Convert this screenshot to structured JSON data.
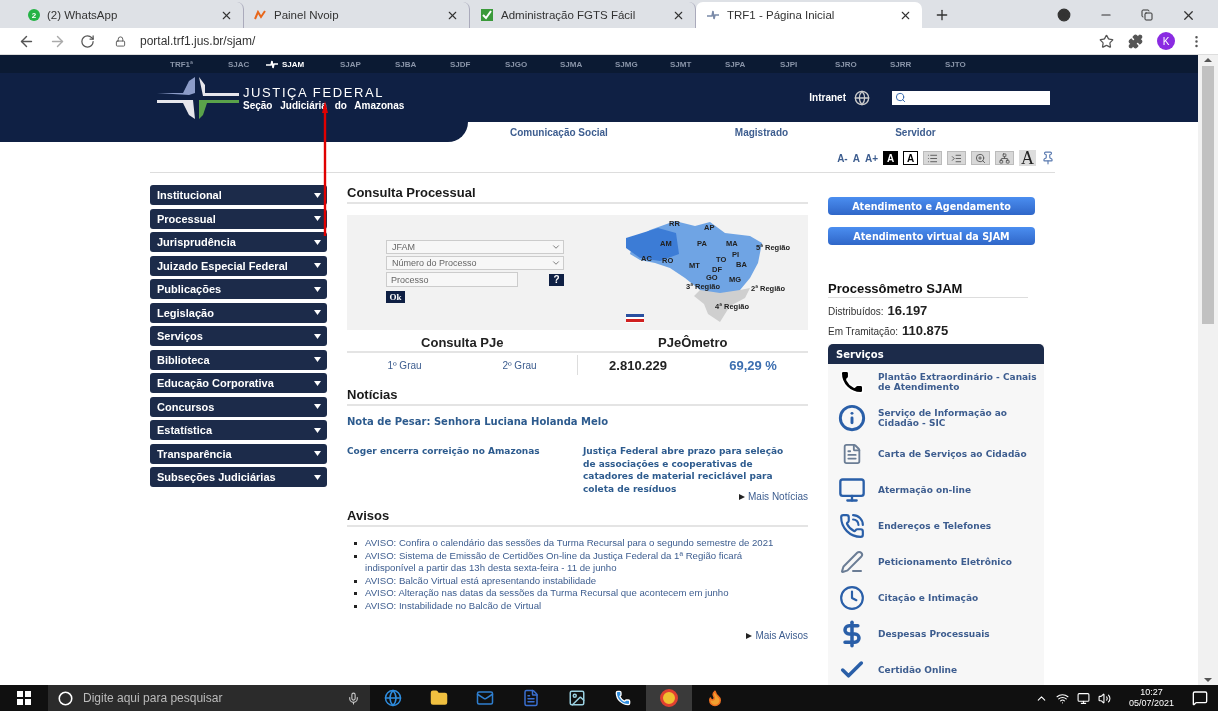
{
  "browser": {
    "tabs": [
      {
        "title": "(2) WhatsApp",
        "kind": "chat",
        "badge": "2",
        "selected": false
      },
      {
        "title": "Painel Nvoip",
        "kind": "zigzag",
        "selected": false
      },
      {
        "title": "Administração FGTS Fácil",
        "kind": "check",
        "selected": false
      },
      {
        "title": "TRF1 - Página Inicial",
        "kind": "logo",
        "selected": true
      }
    ],
    "address": "portal.trf1.jus.br/sjam/",
    "profile": "K"
  },
  "site": {
    "sections": [
      {
        "label": "TRF1ª",
        "selected": false
      },
      {
        "label": "SJAC",
        "selected": false
      },
      {
        "label": "SJAM",
        "selected": true
      },
      {
        "label": "SJAP",
        "selected": false
      },
      {
        "label": "SJBA",
        "selected": false
      },
      {
        "label": "SJDF",
        "selected": false
      },
      {
        "label": "SJGO",
        "selected": false
      },
      {
        "label": "SJMA",
        "selected": false
      },
      {
        "label": "SJMG",
        "selected": false
      },
      {
        "label": "SJMT",
        "selected": false
      },
      {
        "label": "SJPA",
        "selected": false
      },
      {
        "label": "SJPI",
        "selected": false
      },
      {
        "label": "SJRO",
        "selected": false
      },
      {
        "label": "SJRR",
        "selected": false
      },
      {
        "label": "SJTO",
        "selected": false
      }
    ],
    "brand": {
      "title": "JUSTIÇA FEDERAL",
      "subtitle": "Seção Judiciária do Amazonas"
    },
    "intranet": "Intranet",
    "nav": [
      "Comunicação Social",
      "Magistrado",
      "Servidor"
    ],
    "font_controls": [
      "A-",
      "A",
      "A+"
    ],
    "contrast": [
      {
        "label": "A",
        "kind": "dark"
      },
      {
        "label": "A",
        "kind": "light"
      }
    ],
    "large_font": "A"
  },
  "menu": [
    "Institucional",
    "Processual",
    "Jurisprudência",
    "Juizado Especial Federal",
    "Publicações",
    "Legislação",
    "Serviços",
    "Biblioteca",
    "Educação Corporativa",
    "Concursos",
    "Estatística",
    "Transparência",
    "Subseções Judiciárias"
  ],
  "consulta": {
    "title": "Consulta Processual",
    "court": "JFAM",
    "search_by": "Número do Processo",
    "placeholder": "Processo",
    "help": "?",
    "submit": "Ok",
    "map_labels": [
      "RR",
      "AP",
      "AM",
      "PA",
      "MA",
      "5ª Região",
      "PI",
      "AC",
      "RO",
      "TO",
      "BA",
      "MT",
      "DF",
      "GO",
      "MG",
      "3ª Região",
      "2ª Região",
      "4ª Região"
    ]
  },
  "pje": {
    "title": "Consulta PJe",
    "links": [
      "1º Grau",
      "2º Grau"
    ]
  },
  "pjeometro": {
    "title": "PJeÔmetro",
    "count": "2.810.229",
    "percent": "69,29 %"
  },
  "news": {
    "title": "Notícias",
    "headline": "Nota de Pesar: Senhora Luciana Holanda Melo",
    "items": [
      "Coger encerra correição no Amazonas",
      "Justiça Federal abre prazo para seleção de associações e cooperativas de catadores de material reciclável para coleta de resíduos"
    ],
    "more": "Mais Notícias"
  },
  "notices": {
    "title": "Avisos",
    "items": [
      "AVISO: Confira o calendário das sessões da Turma Recursal para o segundo semestre de 2021",
      "AVISO: Sistema de Emissão de Certidões On-line da Justiça Federal da 1ª Região ficará indisponível a partir das 13h desta sexta-feira - 11 de junho",
      "AVISO: Balcão Virtual está apresentando instabilidade",
      "AVISO: Alteração nas datas da sessões da Turma Recursal que acontecem em junho",
      "AVISO: Instabilidade no Balcão de Virtual"
    ],
    "more": "Mais Avisos"
  },
  "buttons": [
    "Atendimento e Agendamento",
    "Atendimento virtual da SJAM"
  ],
  "processometro": {
    "title": "Processômetro SJAM",
    "stats": [
      {
        "label": "Distribuídos:",
        "value": "16.197"
      },
      {
        "label": "Em Tramitação:",
        "value": "110.875"
      }
    ]
  },
  "services": {
    "title": "Serviços",
    "items": [
      {
        "label": "Plantão Extraordinário - Canais de Atendimento",
        "kind": "phone"
      },
      {
        "label": "Serviço de Informação ao Cidadão - SIC",
        "kind": "info"
      },
      {
        "label": "Carta de Serviços ao Cidadão",
        "kind": "document"
      },
      {
        "label": "Atermação on-line",
        "kind": "monitor"
      },
      {
        "label": "Endereços e Telefones",
        "kind": "handset"
      },
      {
        "label": "Peticionamento Eletrônico",
        "kind": "pen"
      },
      {
        "label": "Citação e Intimação",
        "kind": "clock"
      },
      {
        "label": "Despesas Processuais",
        "kind": "dollar"
      },
      {
        "label": "Certidão Online",
        "kind": "check"
      }
    ]
  },
  "taskbar": {
    "search_placeholder": "Digite aqui para pesquisar",
    "time": "10:27",
    "date": "05/07/2021"
  }
}
